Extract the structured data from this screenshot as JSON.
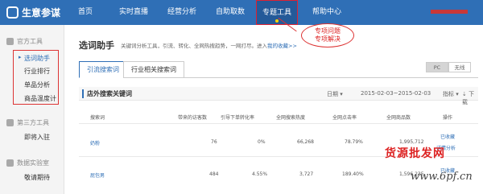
{
  "brand": {
    "name": "生意参谋"
  },
  "nav": {
    "items": [
      "首页",
      "实时直播",
      "经营分析",
      "自助取数",
      "专题工具",
      "帮助中心"
    ]
  },
  "annotation": {
    "line1": "专项问题",
    "line2": "专项解决"
  },
  "sidebar": {
    "groups": [
      "官方工具",
      "第三方工具",
      "数据实验室"
    ],
    "items": [
      "选词助手",
      "行业排行",
      "单品分析",
      "商品温度计",
      "即将入驻",
      "敬请期待"
    ]
  },
  "page": {
    "title": "选词助手",
    "desc": "关键词分析工具，引流、转化、全网热搜趋势，一网打尽。进入",
    "desc_link": "我的收藏>>"
  },
  "tabs": [
    "引流搜索词",
    "行业相关搜索词"
  ],
  "toggle": [
    "PC",
    "无线"
  ],
  "section": {
    "title": "店外搜索关键词",
    "granularity": "日期",
    "date_range": "2015-02-03~2015-02-03",
    "metrics": "指标",
    "download": "下载"
  },
  "table": {
    "headers": [
      "搜索词",
      "带来的访客数",
      "引导下单转化率",
      "全网搜索热度",
      "全网点击率",
      "全网商品数",
      "操作"
    ],
    "rows": [
      {
        "cells": [
          "奶粉",
          "76",
          "0%",
          "66,268",
          "78.79%",
          "1,995,712"
        ],
        "ops": [
          "已收藏",
          "详情分析"
        ]
      },
      {
        "cells": [
          "屁包男",
          "484",
          "4.55%",
          "3,727",
          "189.40%",
          "1,596,235"
        ],
        "ops": [
          "已收藏"
        ]
      }
    ]
  },
  "watermark": {
    "text": "货源批发网",
    "url": "www.6pf.cn"
  },
  "colors": {
    "brand_blue": "#2f6fb6",
    "annotation_red": "#d22"
  }
}
